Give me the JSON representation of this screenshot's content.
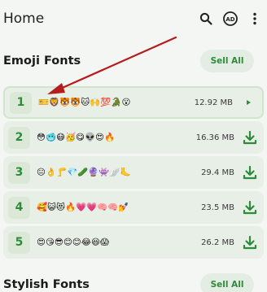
{
  "appbar": {
    "title": "Home",
    "icons": [
      "search-icon",
      "ad-icon",
      "more-vert-icon"
    ]
  },
  "colors": {
    "accent": "#2e8b3a",
    "row_bg": "#e8efe6",
    "arrow": "#b71c1c"
  },
  "emoji_section": {
    "title": "Emoji Fonts",
    "sell_all": "Sell All",
    "rows": [
      {
        "num": "1",
        "emojis": "🎫🦁🐯🐯🐱🙌💯🐊😮",
        "size": "12.92 MB",
        "action": "play-icon"
      },
      {
        "num": "2",
        "emojis": "😳🥶😷🥳😋👽😍🔥",
        "size": "16.36 MB",
        "action": "download-icon"
      },
      {
        "num": "3",
        "emojis": "😐👌🦵💎🥒🔮👾🪽🦶",
        "size": "29.4 MB",
        "action": "download-icon"
      },
      {
        "num": "4",
        "emojis": "🥰😺😻🔥💗💗🧠🧠💅",
        "size": "23.5 MB",
        "action": "download-icon"
      },
      {
        "num": "5",
        "emojis": "😍😘😎😊😊😂😆😱",
        "size": "26.2 MB",
        "action": "download-icon"
      }
    ]
  },
  "stylish_section": {
    "title": "Stylish Fonts",
    "sell_all": "Sell All"
  }
}
